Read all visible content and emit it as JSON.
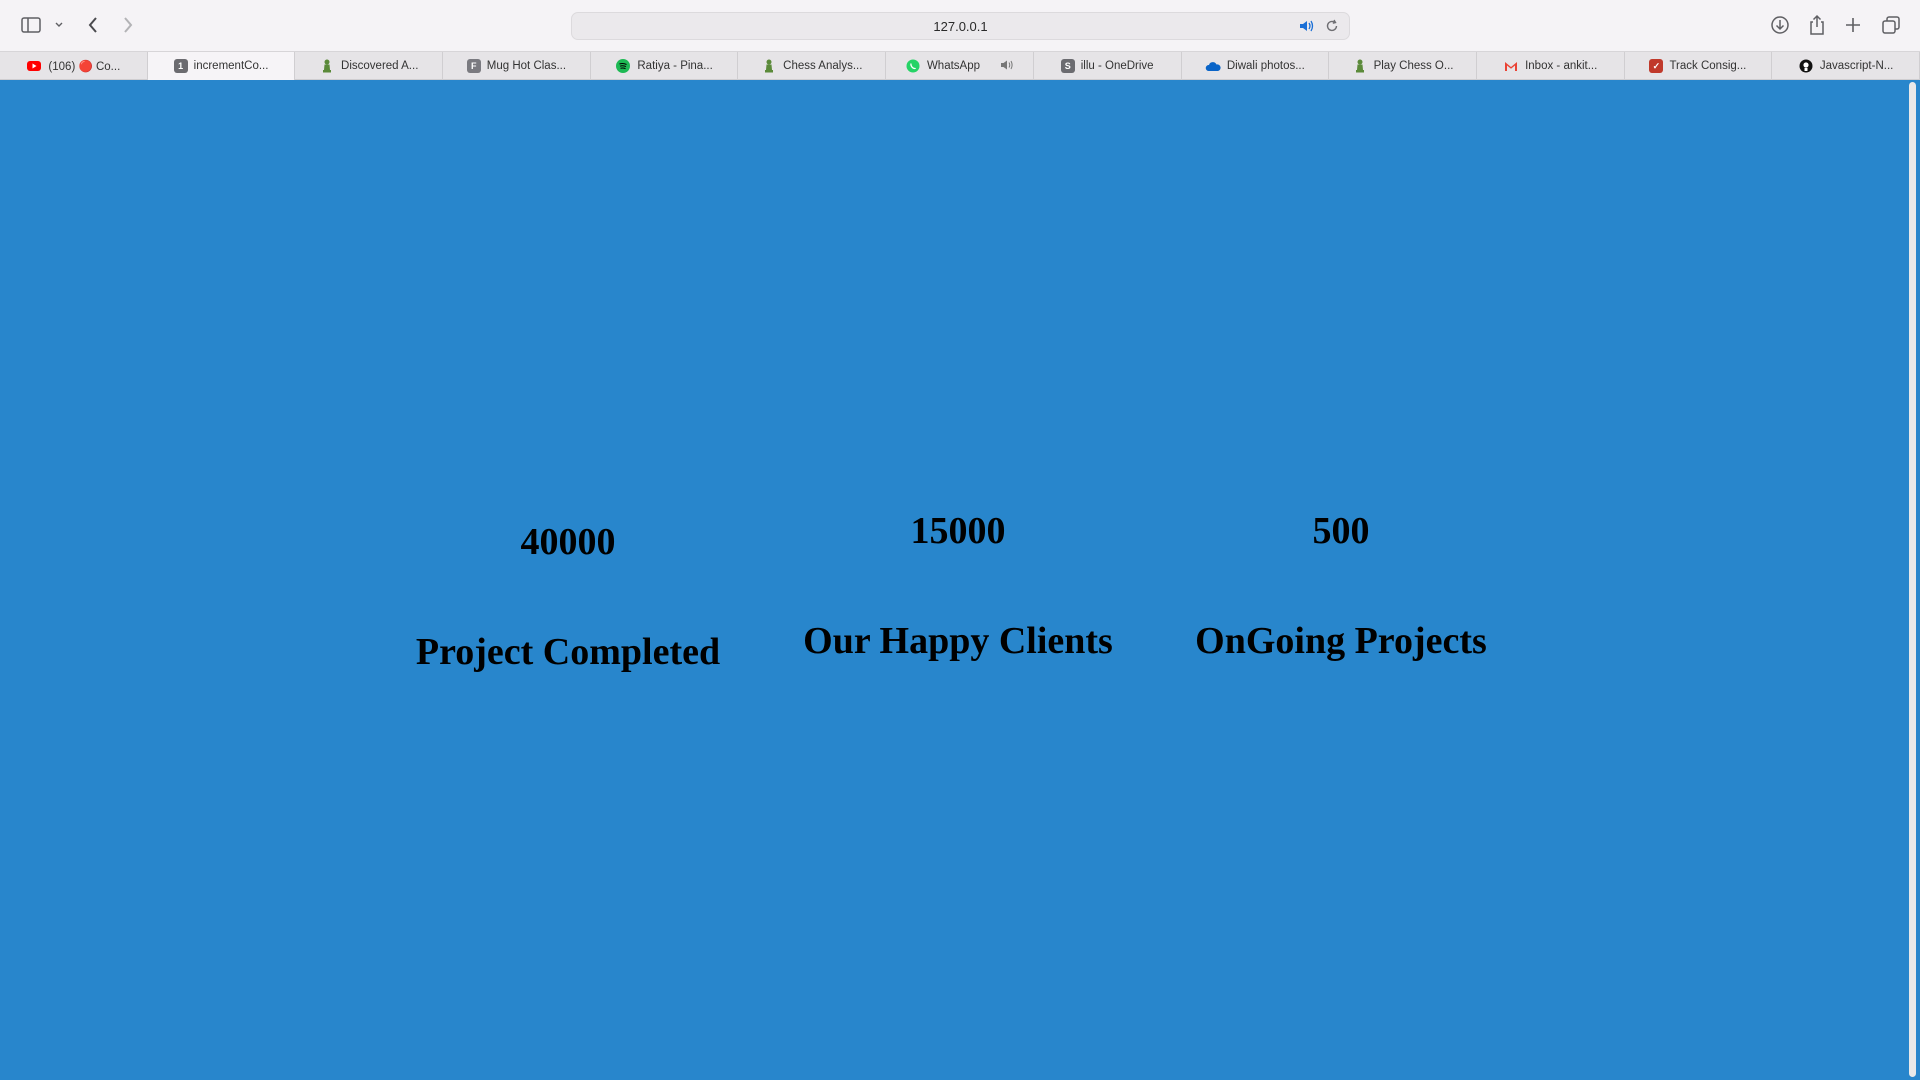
{
  "browser": {
    "address": "127.0.0.1",
    "tabs": [
      {
        "label": "(106) 🔴 Co...",
        "fav": "youtube",
        "color": "#ff0000",
        "letter": ""
      },
      {
        "label": "incrementCo...",
        "fav": "letter",
        "color": "#6b6b70",
        "letter": "1"
      },
      {
        "label": "Discovered A...",
        "fav": "chess",
        "color": "#5b8a3a",
        "letter": ""
      },
      {
        "label": "Mug Hot Clas...",
        "fav": "letter",
        "color": "#7a7a80",
        "letter": "F"
      },
      {
        "label": "Ratiya - Pina...",
        "fav": "spotify",
        "color": "#1db954",
        "letter": ""
      },
      {
        "label": "Chess Analys...",
        "fav": "chess",
        "color": "#5b8a3a",
        "letter": ""
      },
      {
        "label": "WhatsApp",
        "fav": "whatsapp",
        "color": "#25d366",
        "letter": ""
      },
      {
        "label": "illu - OneDrive",
        "fav": "letter",
        "color": "#6b6b70",
        "letter": "S"
      },
      {
        "label": "Diwali photos...",
        "fav": "onedrive",
        "color": "#0a64c8",
        "letter": ""
      },
      {
        "label": "Play Chess O...",
        "fav": "chess",
        "color": "#5b8a3a",
        "letter": ""
      },
      {
        "label": "Inbox - ankit...",
        "fav": "gmail",
        "color": "#ea4335",
        "letter": "M"
      },
      {
        "label": "Track Consig...",
        "fav": "letter",
        "color": "#c0392b",
        "letter": "✓"
      },
      {
        "label": "Javascript-N...",
        "fav": "github",
        "color": "#111111",
        "letter": ""
      }
    ]
  },
  "stats": {
    "projects_completed": {
      "value": "40000",
      "label": "Project Completed"
    },
    "happy_clients": {
      "value": "15000",
      "label": "Our Happy Clients"
    },
    "ongoing_projects": {
      "value": "500",
      "label": "OnGoing Projects"
    }
  },
  "colors": {
    "page_background": "#2886cc",
    "text": "#000000"
  }
}
